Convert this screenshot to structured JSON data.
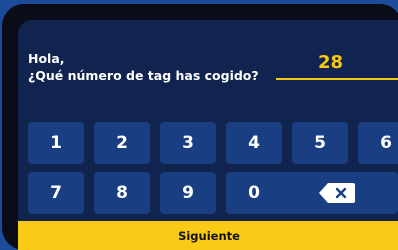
{
  "prompt": {
    "greeting": "Hola,",
    "question": "¿Qué número de tag has cogido?"
  },
  "tag_input": {
    "value": "28"
  },
  "keypad": {
    "row1": [
      "1",
      "2",
      "3",
      "4",
      "5",
      "6"
    ],
    "row2": [
      "7",
      "8",
      "9",
      "0"
    ],
    "backspace_icon": "backspace-icon"
  },
  "next_button": {
    "label": "Siguiente"
  },
  "colors": {
    "accent": "#f6c914",
    "screen_bg": "#11244f",
    "key_bg": "#1a3e82",
    "page_bg": "#1b4b9a"
  }
}
